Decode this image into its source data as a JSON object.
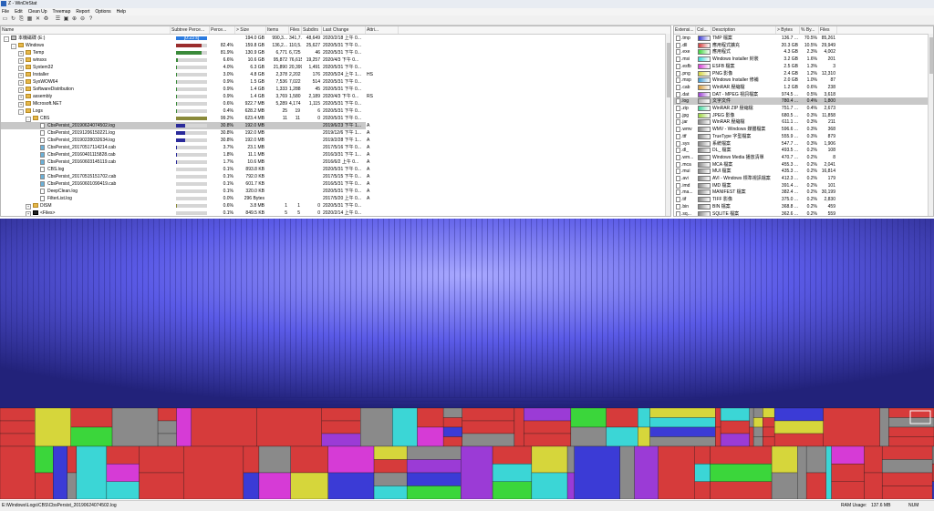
{
  "window": {
    "title": "Z - WinDirStat"
  },
  "menu": [
    "File",
    "Edit",
    "Clean Up",
    "Treemap",
    "Report",
    "Options",
    "Help"
  ],
  "toolbar_icons": [
    "open-icon",
    "refresh-icon",
    "copy-icon",
    "select-icon",
    "delete-icon",
    "recycle-icon",
    "properties-icon",
    "explorer-icon",
    "zoom-in-icon",
    "zoom-out-icon",
    "help-icon"
  ],
  "tree": {
    "columns": [
      "Name",
      "Subtree Perce...",
      "Perce...",
      "> Size",
      "Items",
      "Files",
      "Subdirs",
      "Last Change",
      "Attri..."
    ],
    "rows": [
      {
        "depth": 0,
        "exp": "-",
        "icon": "drive",
        "name": "本機磁碟 (E:)",
        "pct_bar": 1.0,
        "pct_color": "#2b7be0",
        "bar_text": "[0:23 s]",
        "percent": "",
        "size": "194.0 GB",
        "items": "990,3...",
        "files": "341,7...",
        "subdirs": "48,649",
        "date": "2020/2/18  上午 0...",
        "attr": ""
      },
      {
        "depth": 1,
        "exp": "-",
        "icon": "folder",
        "name": "Windows",
        "pct_bar": 0.824,
        "pct_color": "#9b2d2d",
        "percent": "82.4%",
        "size": "159.8 GB",
        "items": "136,2...",
        "files": "110,5...",
        "subdirs": "25,627",
        "date": "2020/5/31  下午 0...",
        "attr": ""
      },
      {
        "depth": 2,
        "exp": "+",
        "icon": "folder",
        "name": "Temp",
        "pct_bar": 0.819,
        "pct_color": "#3a8a3a",
        "percent": "81.9%",
        "size": "130.9 GB",
        "items": "6,771",
        "files": "6,725",
        "subdirs": "46",
        "date": "2020/5/31  下午 0...",
        "attr": ""
      },
      {
        "depth": 2,
        "exp": "+",
        "icon": "folder",
        "name": "winsxs",
        "pct_bar": 0.066,
        "pct_color": "#3a8a3a",
        "percent": "6.6%",
        "size": "10.6 GB",
        "items": "95,872",
        "files": "76,615",
        "subdirs": "19,257",
        "date": "2020/4/3  下午 0...",
        "attr": ""
      },
      {
        "depth": 2,
        "exp": "+",
        "icon": "folder",
        "name": "System32",
        "pct_bar": 0.04,
        "pct_color": "#3a8a3a",
        "percent": "4.0%",
        "size": "6.3 GB",
        "items": "21,890",
        "files": "20,399",
        "subdirs": "1,491",
        "date": "2020/5/31  下午 0...",
        "attr": ""
      },
      {
        "depth": 2,
        "exp": "+",
        "icon": "folder",
        "name": "Installer",
        "pct_bar": 0.03,
        "pct_color": "#3a8a3a",
        "percent": "3.0%",
        "size": "4.8 GB",
        "items": "2,378",
        "files": "2,202",
        "subdirs": "176",
        "date": "2020/5/24  上午 1...",
        "attr": "HS"
      },
      {
        "depth": 2,
        "exp": "+",
        "icon": "folder",
        "name": "SysWOW64",
        "pct_bar": 0.009,
        "pct_color": "#3a8a3a",
        "percent": "0.9%",
        "size": "1.5 GB",
        "items": "7,536",
        "files": "7,022",
        "subdirs": "514",
        "date": "2020/5/31  下午 0...",
        "attr": ""
      },
      {
        "depth": 2,
        "exp": "+",
        "icon": "folder",
        "name": "SoftwareDistribution",
        "pct_bar": 0.009,
        "pct_color": "#3a8a3a",
        "percent": "0.9%",
        "size": "1.4 GB",
        "items": "1,333",
        "files": "1,288",
        "subdirs": "45",
        "date": "2020/5/31  下午 0...",
        "attr": ""
      },
      {
        "depth": 2,
        "exp": "+",
        "icon": "folder",
        "name": "assembly",
        "pct_bar": 0.009,
        "pct_color": "#3a8a3a",
        "percent": "0.9%",
        "size": "1.4 GB",
        "items": "3,769",
        "files": "1,580",
        "subdirs": "2,189",
        "date": "2020/4/3  下午 0...",
        "attr": "RS"
      },
      {
        "depth": 2,
        "exp": "+",
        "icon": "folder",
        "name": "Microsoft.NET",
        "pct_bar": 0.006,
        "pct_color": "#3a8a3a",
        "percent": "0.6%",
        "size": "922.7 MB",
        "items": "5,289",
        "files": "4,174",
        "subdirs": "1,115",
        "date": "2020/5/31  下午 0...",
        "attr": ""
      },
      {
        "depth": 2,
        "exp": "-",
        "icon": "folder",
        "name": "Logs",
        "pct_bar": 0.004,
        "pct_color": "#3a8a3a",
        "percent": "0.4%",
        "size": "628.2 MB",
        "items": "25",
        "files": "19",
        "subdirs": "6",
        "date": "2020/5/31  下午 0...",
        "attr": ""
      },
      {
        "depth": 3,
        "exp": "-",
        "icon": "folder",
        "name": "CBS",
        "pct_bar": 0.992,
        "pct_color": "#8a8a3a",
        "percent": "99.2%",
        "size": "623.4 MB",
        "items": "11",
        "files": "11",
        "subdirs": "0",
        "date": "2020/5/31  下午 0...",
        "attr": ""
      },
      {
        "depth": 4,
        "exp": "",
        "icon": "file",
        "name": "CbsPersist_20190624074502.log",
        "pct_bar": 0.308,
        "pct_color": "#2b2b9b",
        "percent": "30.8%",
        "size": "192.0 MB",
        "items": "",
        "files": "",
        "subdirs": "",
        "date": "2019/6/23  下午 1...",
        "attr": "A",
        "selected": true
      },
      {
        "depth": 4,
        "exp": "",
        "icon": "file",
        "name": "CbsPersist_20191206150221.log",
        "pct_bar": 0.308,
        "pct_color": "#2b2b9b",
        "percent": "30.8%",
        "size": "192.0 MB",
        "items": "",
        "files": "",
        "subdirs": "",
        "date": "2019/12/6  下午 1...",
        "attr": "A"
      },
      {
        "depth": 4,
        "exp": "",
        "icon": "file",
        "name": "CbsPersist_20190228032634.log",
        "pct_bar": 0.308,
        "pct_color": "#2b2b9b",
        "percent": "30.8%",
        "size": "192.0 MB",
        "items": "",
        "files": "",
        "subdirs": "",
        "date": "2019/2/28  下午 1...",
        "attr": "A"
      },
      {
        "depth": 4,
        "exp": "",
        "icon": "cab",
        "name": "CbsPersist_20170517114214.cab",
        "pct_bar": 0.037,
        "pct_color": "#2b2b9b",
        "percent": "3.7%",
        "size": "23.1 MB",
        "items": "",
        "files": "",
        "subdirs": "",
        "date": "2017/5/16  下午 0...",
        "attr": "A"
      },
      {
        "depth": 4,
        "exp": "",
        "icon": "cab",
        "name": "CbsPersist_20160401115828.cab",
        "pct_bar": 0.018,
        "pct_color": "#2b2b9b",
        "percent": "1.8%",
        "size": "11.1 MB",
        "items": "",
        "files": "",
        "subdirs": "",
        "date": "2016/3/31  下午 1...",
        "attr": "A"
      },
      {
        "depth": 4,
        "exp": "",
        "icon": "cab",
        "name": "CbsPersist_20160603145119.cab",
        "pct_bar": 0.017,
        "pct_color": "#2b2b9b",
        "percent": "1.7%",
        "size": "10.6 MB",
        "items": "",
        "files": "",
        "subdirs": "",
        "date": "2016/6/2  上午 0...",
        "attr": "A"
      },
      {
        "depth": 4,
        "exp": "",
        "icon": "file",
        "name": "CBS.log",
        "pct_bar": 0.001,
        "pct_color": "#2b2b9b",
        "percent": "0.1%",
        "size": "893.8 KB",
        "items": "",
        "files": "",
        "subdirs": "",
        "date": "2020/5/31  下午 0...",
        "attr": "A"
      },
      {
        "depth": 4,
        "exp": "",
        "icon": "cab",
        "name": "CbsPersist_20170515151702.cab",
        "pct_bar": 0.001,
        "pct_color": "#2b2b9b",
        "percent": "0.1%",
        "size": "792.0 KB",
        "items": "",
        "files": "",
        "subdirs": "",
        "date": "2017/5/15  下午 0...",
        "attr": "A"
      },
      {
        "depth": 4,
        "exp": "",
        "icon": "cab",
        "name": "CbsPersist_20160601090419.cab",
        "pct_bar": 0.001,
        "pct_color": "#2b2b9b",
        "percent": "0.1%",
        "size": "601.7 KB",
        "items": "",
        "files": "",
        "subdirs": "",
        "date": "2016/5/31  下午 0...",
        "attr": "A"
      },
      {
        "depth": 4,
        "exp": "",
        "icon": "file",
        "name": "DeepClean.log",
        "pct_bar": 0.001,
        "pct_color": "#2b2b9b",
        "percent": "0.1%",
        "size": "320.0 KB",
        "items": "",
        "files": "",
        "subdirs": "",
        "date": "2020/5/31  下午 0...",
        "attr": "A"
      },
      {
        "depth": 4,
        "exp": "",
        "icon": "file",
        "name": "FilterList.log",
        "pct_bar": 0.0,
        "pct_color": "#2b2b9b",
        "percent": "0.0%",
        "size": "296 Bytes",
        "items": "",
        "files": "",
        "subdirs": "",
        "date": "2017/5/20  上午 0...",
        "attr": "A"
      },
      {
        "depth": 3,
        "exp": "+",
        "icon": "folder",
        "name": "DISM",
        "pct_bar": 0.006,
        "pct_color": "#8a8a3a",
        "percent": "0.6%",
        "size": "3.8 MB",
        "items": "1",
        "files": "1",
        "subdirs": "0",
        "date": "2020/5/31  下午 0...",
        "attr": ""
      },
      {
        "depth": 3,
        "exp": "+",
        "icon": "files",
        "name": "<Files>",
        "pct_bar": 0.001,
        "pct_color": "#8a8a3a",
        "percent": "0.1%",
        "size": "849.5 KB",
        "items": "5",
        "files": "5",
        "subdirs": "0",
        "date": "2020/2/14  上午 0...",
        "attr": ""
      }
    ]
  },
  "extensions": {
    "columns": [
      "Extensi...",
      "Col...",
      "Description",
      "> Bytes",
      "% By...",
      "Files"
    ],
    "rows": [
      {
        "ext": ".tmp",
        "color": "#3b3bd6",
        "desc": "TMP 檔案",
        "bytes": "136.7 ...",
        "pct": "70.5%",
        "files": "85,261"
      },
      {
        "ext": ".dll",
        "color": "#d63b3b",
        "desc": "應用程式擴充",
        "bytes": "20.3 GB",
        "pct": "10.5%",
        "files": "29,949"
      },
      {
        "ext": ".exe",
        "color": "#3bd63b",
        "desc": "應用程式",
        "bytes": "4.3 GB",
        "pct": "2.3%",
        "files": "4,002"
      },
      {
        "ext": ".msi",
        "color": "#3bd6d6",
        "desc": "Windows Installer 封裝",
        "bytes": "3.2 GB",
        "pct": "1.6%",
        "files": "201"
      },
      {
        "ext": ".esfb",
        "color": "#d63bd6",
        "desc": "ESFB 檔案",
        "bytes": "2.5 GB",
        "pct": "1.3%",
        "files": "3"
      },
      {
        "ext": ".png",
        "color": "#d6d63b",
        "desc": "PNG 影像",
        "bytes": "2.4 GB",
        "pct": "1.2%",
        "files": "12,310"
      },
      {
        "ext": ".msp",
        "color": "#3b9bd6",
        "desc": "Windows Installer 修補",
        "bytes": "2.0 GB",
        "pct": "1.0%",
        "files": "87"
      },
      {
        "ext": ".cab",
        "color": "#d69b3b",
        "desc": "WinRAR 壓縮檔",
        "bytes": "1.2 GB",
        "pct": "0.6%",
        "files": "238"
      },
      {
        "ext": ".dat",
        "color": "#9b3bd6",
        "desc": "DAT - MPEG 視訊檔案",
        "bytes": "974.5 ...",
        "pct": "0.5%",
        "files": "3,618"
      },
      {
        "ext": ".log",
        "color": "#b0b0b0",
        "desc": "文字文件",
        "bytes": "780.4 ...",
        "pct": "0.4%",
        "files": "1,800",
        "selected": true
      },
      {
        "ext": ".zip",
        "color": "#3bd69b",
        "desc": "WinRAR ZIP 壓縮檔",
        "bytes": "751.7 ...",
        "pct": "0.4%",
        "files": "2,673"
      },
      {
        "ext": ".jpg",
        "color": "#9bd63b",
        "desc": "JPEG 影像",
        "bytes": "680.5 ...",
        "pct": "0.3%",
        "files": "11,858"
      },
      {
        "ext": ".jar",
        "color": "#8a8a8a",
        "desc": "WinRAR 壓縮檔",
        "bytes": "611.1 ...",
        "pct": "0.3%",
        "files": "211"
      },
      {
        "ext": ".wmv",
        "color": "#8a8a8a",
        "desc": "WMV - Windows 媒體檔案",
        "bytes": "596.6 ...",
        "pct": "0.3%",
        "files": "368"
      },
      {
        "ext": ".ttf",
        "color": "#8a8a8a",
        "desc": "TrueType 字型檔案",
        "bytes": "555.9 ...",
        "pct": "0.3%",
        "files": "879"
      },
      {
        "ext": ".sys",
        "color": "#8a8a8a",
        "desc": "系統檔案",
        "bytes": "547.7 ...",
        "pct": "0.3%",
        "files": "1,906"
      },
      {
        "ext": ".dl_",
        "color": "#8a8a8a",
        "desc": "DL_ 檔案",
        "bytes": "493.5 ...",
        "pct": "0.2%",
        "files": "108"
      },
      {
        "ext": ".wm...",
        "color": "#8a8a8a",
        "desc": "Windows Media 播放清單",
        "bytes": "470.7 ...",
        "pct": "0.2%",
        "files": "8"
      },
      {
        "ext": ".mca",
        "color": "#8a8a8a",
        "desc": "MCA 檔案",
        "bytes": "455.3 ...",
        "pct": "0.2%",
        "files": "2,041"
      },
      {
        "ext": ".mui",
        "color": "#8a8a8a",
        "desc": "MUI 檔案",
        "bytes": "435.3 ...",
        "pct": "0.2%",
        "files": "16,814"
      },
      {
        "ext": ".avi",
        "color": "#8a8a8a",
        "desc": "AVI - Windows 標準視訊檔案",
        "bytes": "412.3 ...",
        "pct": "0.2%",
        "files": "179"
      },
      {
        "ext": ".imd",
        "color": "#8a8a8a",
        "desc": "IMD 檔案",
        "bytes": "391.4 ...",
        "pct": "0.2%",
        "files": "101"
      },
      {
        "ext": ".ma...",
        "color": "#8a8a8a",
        "desc": "MANIFEST 檔案",
        "bytes": "382.4 ...",
        "pct": "0.2%",
        "files": "30,199"
      },
      {
        "ext": ".tif",
        "color": "#8a8a8a",
        "desc": "TIFF 影像",
        "bytes": "375.0 ...",
        "pct": "0.2%",
        "files": "2,830"
      },
      {
        "ext": ".bin",
        "color": "#8a8a8a",
        "desc": "BIN 檔案",
        "bytes": "368.8 ...",
        "pct": "0.2%",
        "files": "459"
      },
      {
        "ext": ".sq...",
        "color": "#8a8a8a",
        "desc": "SQLITE 檔案",
        "bytes": "362.6 ...",
        "pct": "0.2%",
        "files": "559"
      }
    ]
  },
  "status": {
    "path": "E:\\Windows\\Logs\\CBS\\CbsPersist_20190624074502.log",
    "ram_label": "RAM Usage:",
    "ram_value": "137.6 MB",
    "num": "NUM"
  },
  "treemap_colors": [
    "#3b3bd6",
    "#d63b3b",
    "#3bd63b",
    "#3bd6d6",
    "#d63bd6",
    "#d6d63b",
    "#8a8a8a",
    "#9b3bd6"
  ]
}
